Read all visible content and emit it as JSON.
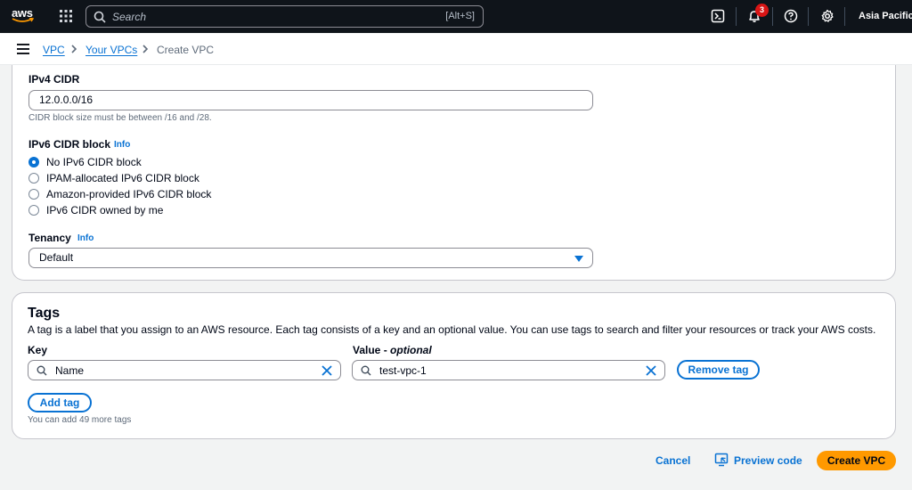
{
  "topnav": {
    "logo": "aws",
    "search_placeholder": "Search",
    "search_shortcut": "[Alt+S]",
    "notification_count": "3",
    "region": "Asia Pacific (Mu"
  },
  "breadcrumb": {
    "items": [
      "VPC",
      "Your VPCs",
      "Create VPC"
    ]
  },
  "ipv4": {
    "label": "IPv4 CIDR",
    "value": "12.0.0.0/16",
    "hint": "CIDR block size must be between /16 and /28."
  },
  "ipv6": {
    "label": "IPv6 CIDR block",
    "info": "Info",
    "options": [
      "No IPv6 CIDR block",
      "IPAM-allocated IPv6 CIDR block",
      "Amazon-provided IPv6 CIDR block",
      "IPv6 CIDR owned by me"
    ],
    "selected": 0
  },
  "tenancy": {
    "label": "Tenancy",
    "info": "Info",
    "value": "Default"
  },
  "tags": {
    "title": "Tags",
    "description": "A tag is a label that you assign to an AWS resource. Each tag consists of a key and an optional value. You can use tags to search and filter your resources or track your AWS costs.",
    "key_label": "Key",
    "value_label": "Value - ",
    "value_label_optional": "optional",
    "key_value": "Name",
    "value_value": "test-vpc-1",
    "remove_label": "Remove tag",
    "add_label": "Add tag",
    "remaining_hint": "You can add 49 more tags"
  },
  "actions": {
    "cancel": "Cancel",
    "preview": "Preview code",
    "create": "Create VPC"
  },
  "colors": {
    "accent": "#0972d3",
    "primary_button": "#ff9900",
    "topnav_bg": "#0f141a",
    "badge": "#d91515"
  }
}
